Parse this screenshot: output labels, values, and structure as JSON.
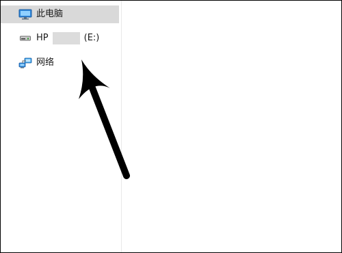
{
  "nav": {
    "items": [
      {
        "label": "此电脑",
        "icon": "computer-icon",
        "selected": true
      },
      {
        "label": "HP",
        "suffix": "(E:)",
        "icon": "drive-icon",
        "selected": false
      },
      {
        "label": "网络",
        "icon": "network-icon",
        "selected": false
      }
    ]
  },
  "colors": {
    "selected_bg": "#d9d9d9",
    "redaction": "#dcdcdc",
    "annotation_arrow": "#000000"
  }
}
